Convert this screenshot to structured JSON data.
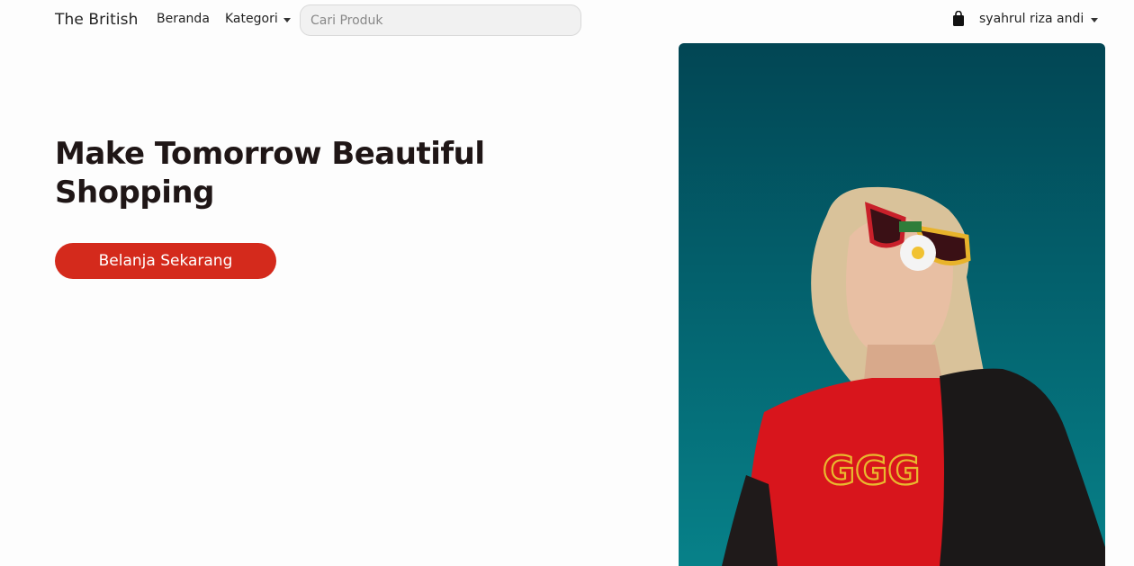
{
  "navbar": {
    "brand": "The British",
    "links": {
      "home": "Beranda",
      "category": "Kategori"
    },
    "search": {
      "placeholder": "Cari Produk",
      "value": ""
    },
    "cart_icon": "shopping-bag-icon",
    "user": {
      "name": "syahrul riza andi"
    }
  },
  "hero": {
    "title": "Make Tomorrow Beautiful Shopping",
    "cta_label": "Belanja Sekarang",
    "image_alt": "model-photo"
  },
  "colors": {
    "accent": "#d42a1c",
    "text_dark": "#1f1616",
    "image_bg_top": "#024654",
    "image_bg_bottom": "#078189"
  }
}
